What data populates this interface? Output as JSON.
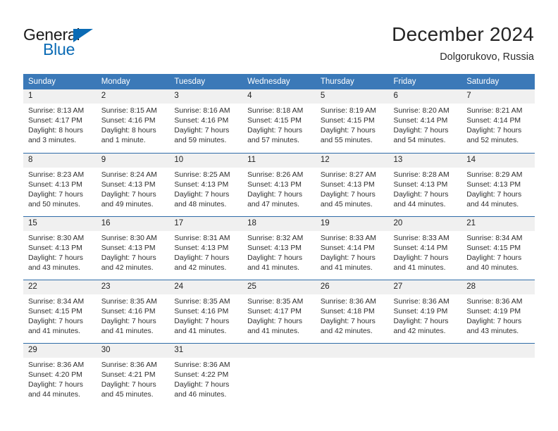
{
  "brand": {
    "name_part1": "General",
    "name_part2": "Blue",
    "triangle_icon": "triangle-icon",
    "accent_color": "#0b6bb5"
  },
  "header": {
    "title": "December 2024",
    "subtitle": "Dolgorukovo, Russia"
  },
  "theme": {
    "header_blue": "#3b79b8",
    "row_divider_blue": "#2f6ca8",
    "daynum_band": "#f0f0f0"
  },
  "weekday_headers": [
    "Sunday",
    "Monday",
    "Tuesday",
    "Wednesday",
    "Thursday",
    "Friday",
    "Saturday"
  ],
  "weeks": [
    [
      {
        "day": "1",
        "sunrise": "Sunrise: 8:13 AM",
        "sunset": "Sunset: 4:17 PM",
        "daylight1": "Daylight: 8 hours",
        "daylight2": "and 3 minutes."
      },
      {
        "day": "2",
        "sunrise": "Sunrise: 8:15 AM",
        "sunset": "Sunset: 4:16 PM",
        "daylight1": "Daylight: 8 hours",
        "daylight2": "and 1 minute."
      },
      {
        "day": "3",
        "sunrise": "Sunrise: 8:16 AM",
        "sunset": "Sunset: 4:16 PM",
        "daylight1": "Daylight: 7 hours",
        "daylight2": "and 59 minutes."
      },
      {
        "day": "4",
        "sunrise": "Sunrise: 8:18 AM",
        "sunset": "Sunset: 4:15 PM",
        "daylight1": "Daylight: 7 hours",
        "daylight2": "and 57 minutes."
      },
      {
        "day": "5",
        "sunrise": "Sunrise: 8:19 AM",
        "sunset": "Sunset: 4:15 PM",
        "daylight1": "Daylight: 7 hours",
        "daylight2": "and 55 minutes."
      },
      {
        "day": "6",
        "sunrise": "Sunrise: 8:20 AM",
        "sunset": "Sunset: 4:14 PM",
        "daylight1": "Daylight: 7 hours",
        "daylight2": "and 54 minutes."
      },
      {
        "day": "7",
        "sunrise": "Sunrise: 8:21 AM",
        "sunset": "Sunset: 4:14 PM",
        "daylight1": "Daylight: 7 hours",
        "daylight2": "and 52 minutes."
      }
    ],
    [
      {
        "day": "8",
        "sunrise": "Sunrise: 8:23 AM",
        "sunset": "Sunset: 4:13 PM",
        "daylight1": "Daylight: 7 hours",
        "daylight2": "and 50 minutes."
      },
      {
        "day": "9",
        "sunrise": "Sunrise: 8:24 AM",
        "sunset": "Sunset: 4:13 PM",
        "daylight1": "Daylight: 7 hours",
        "daylight2": "and 49 minutes."
      },
      {
        "day": "10",
        "sunrise": "Sunrise: 8:25 AM",
        "sunset": "Sunset: 4:13 PM",
        "daylight1": "Daylight: 7 hours",
        "daylight2": "and 48 minutes."
      },
      {
        "day": "11",
        "sunrise": "Sunrise: 8:26 AM",
        "sunset": "Sunset: 4:13 PM",
        "daylight1": "Daylight: 7 hours",
        "daylight2": "and 47 minutes."
      },
      {
        "day": "12",
        "sunrise": "Sunrise: 8:27 AM",
        "sunset": "Sunset: 4:13 PM",
        "daylight1": "Daylight: 7 hours",
        "daylight2": "and 45 minutes."
      },
      {
        "day": "13",
        "sunrise": "Sunrise: 8:28 AM",
        "sunset": "Sunset: 4:13 PM",
        "daylight1": "Daylight: 7 hours",
        "daylight2": "and 44 minutes."
      },
      {
        "day": "14",
        "sunrise": "Sunrise: 8:29 AM",
        "sunset": "Sunset: 4:13 PM",
        "daylight1": "Daylight: 7 hours",
        "daylight2": "and 44 minutes."
      }
    ],
    [
      {
        "day": "15",
        "sunrise": "Sunrise: 8:30 AM",
        "sunset": "Sunset: 4:13 PM",
        "daylight1": "Daylight: 7 hours",
        "daylight2": "and 43 minutes."
      },
      {
        "day": "16",
        "sunrise": "Sunrise: 8:30 AM",
        "sunset": "Sunset: 4:13 PM",
        "daylight1": "Daylight: 7 hours",
        "daylight2": "and 42 minutes."
      },
      {
        "day": "17",
        "sunrise": "Sunrise: 8:31 AM",
        "sunset": "Sunset: 4:13 PM",
        "daylight1": "Daylight: 7 hours",
        "daylight2": "and 42 minutes."
      },
      {
        "day": "18",
        "sunrise": "Sunrise: 8:32 AM",
        "sunset": "Sunset: 4:13 PM",
        "daylight1": "Daylight: 7 hours",
        "daylight2": "and 41 minutes."
      },
      {
        "day": "19",
        "sunrise": "Sunrise: 8:33 AM",
        "sunset": "Sunset: 4:14 PM",
        "daylight1": "Daylight: 7 hours",
        "daylight2": "and 41 minutes."
      },
      {
        "day": "20",
        "sunrise": "Sunrise: 8:33 AM",
        "sunset": "Sunset: 4:14 PM",
        "daylight1": "Daylight: 7 hours",
        "daylight2": "and 41 minutes."
      },
      {
        "day": "21",
        "sunrise": "Sunrise: 8:34 AM",
        "sunset": "Sunset: 4:15 PM",
        "daylight1": "Daylight: 7 hours",
        "daylight2": "and 40 minutes."
      }
    ],
    [
      {
        "day": "22",
        "sunrise": "Sunrise: 8:34 AM",
        "sunset": "Sunset: 4:15 PM",
        "daylight1": "Daylight: 7 hours",
        "daylight2": "and 41 minutes."
      },
      {
        "day": "23",
        "sunrise": "Sunrise: 8:35 AM",
        "sunset": "Sunset: 4:16 PM",
        "daylight1": "Daylight: 7 hours",
        "daylight2": "and 41 minutes."
      },
      {
        "day": "24",
        "sunrise": "Sunrise: 8:35 AM",
        "sunset": "Sunset: 4:16 PM",
        "daylight1": "Daylight: 7 hours",
        "daylight2": "and 41 minutes."
      },
      {
        "day": "25",
        "sunrise": "Sunrise: 8:35 AM",
        "sunset": "Sunset: 4:17 PM",
        "daylight1": "Daylight: 7 hours",
        "daylight2": "and 41 minutes."
      },
      {
        "day": "26",
        "sunrise": "Sunrise: 8:36 AM",
        "sunset": "Sunset: 4:18 PM",
        "daylight1": "Daylight: 7 hours",
        "daylight2": "and 42 minutes."
      },
      {
        "day": "27",
        "sunrise": "Sunrise: 8:36 AM",
        "sunset": "Sunset: 4:19 PM",
        "daylight1": "Daylight: 7 hours",
        "daylight2": "and 42 minutes."
      },
      {
        "day": "28",
        "sunrise": "Sunrise: 8:36 AM",
        "sunset": "Sunset: 4:19 PM",
        "daylight1": "Daylight: 7 hours",
        "daylight2": "and 43 minutes."
      }
    ],
    [
      {
        "day": "29",
        "sunrise": "Sunrise: 8:36 AM",
        "sunset": "Sunset: 4:20 PM",
        "daylight1": "Daylight: 7 hours",
        "daylight2": "and 44 minutes."
      },
      {
        "day": "30",
        "sunrise": "Sunrise: 8:36 AM",
        "sunset": "Sunset: 4:21 PM",
        "daylight1": "Daylight: 7 hours",
        "daylight2": "and 45 minutes."
      },
      {
        "day": "31",
        "sunrise": "Sunrise: 8:36 AM",
        "sunset": "Sunset: 4:22 PM",
        "daylight1": "Daylight: 7 hours",
        "daylight2": "and 46 minutes."
      },
      {
        "day": "",
        "sunrise": "",
        "sunset": "",
        "daylight1": "",
        "daylight2": "",
        "blank": true
      },
      {
        "day": "",
        "sunrise": "",
        "sunset": "",
        "daylight1": "",
        "daylight2": "",
        "blank": true
      },
      {
        "day": "",
        "sunrise": "",
        "sunset": "",
        "daylight1": "",
        "daylight2": "",
        "blank": true
      },
      {
        "day": "",
        "sunrise": "",
        "sunset": "",
        "daylight1": "",
        "daylight2": "",
        "blank": true
      }
    ]
  ]
}
